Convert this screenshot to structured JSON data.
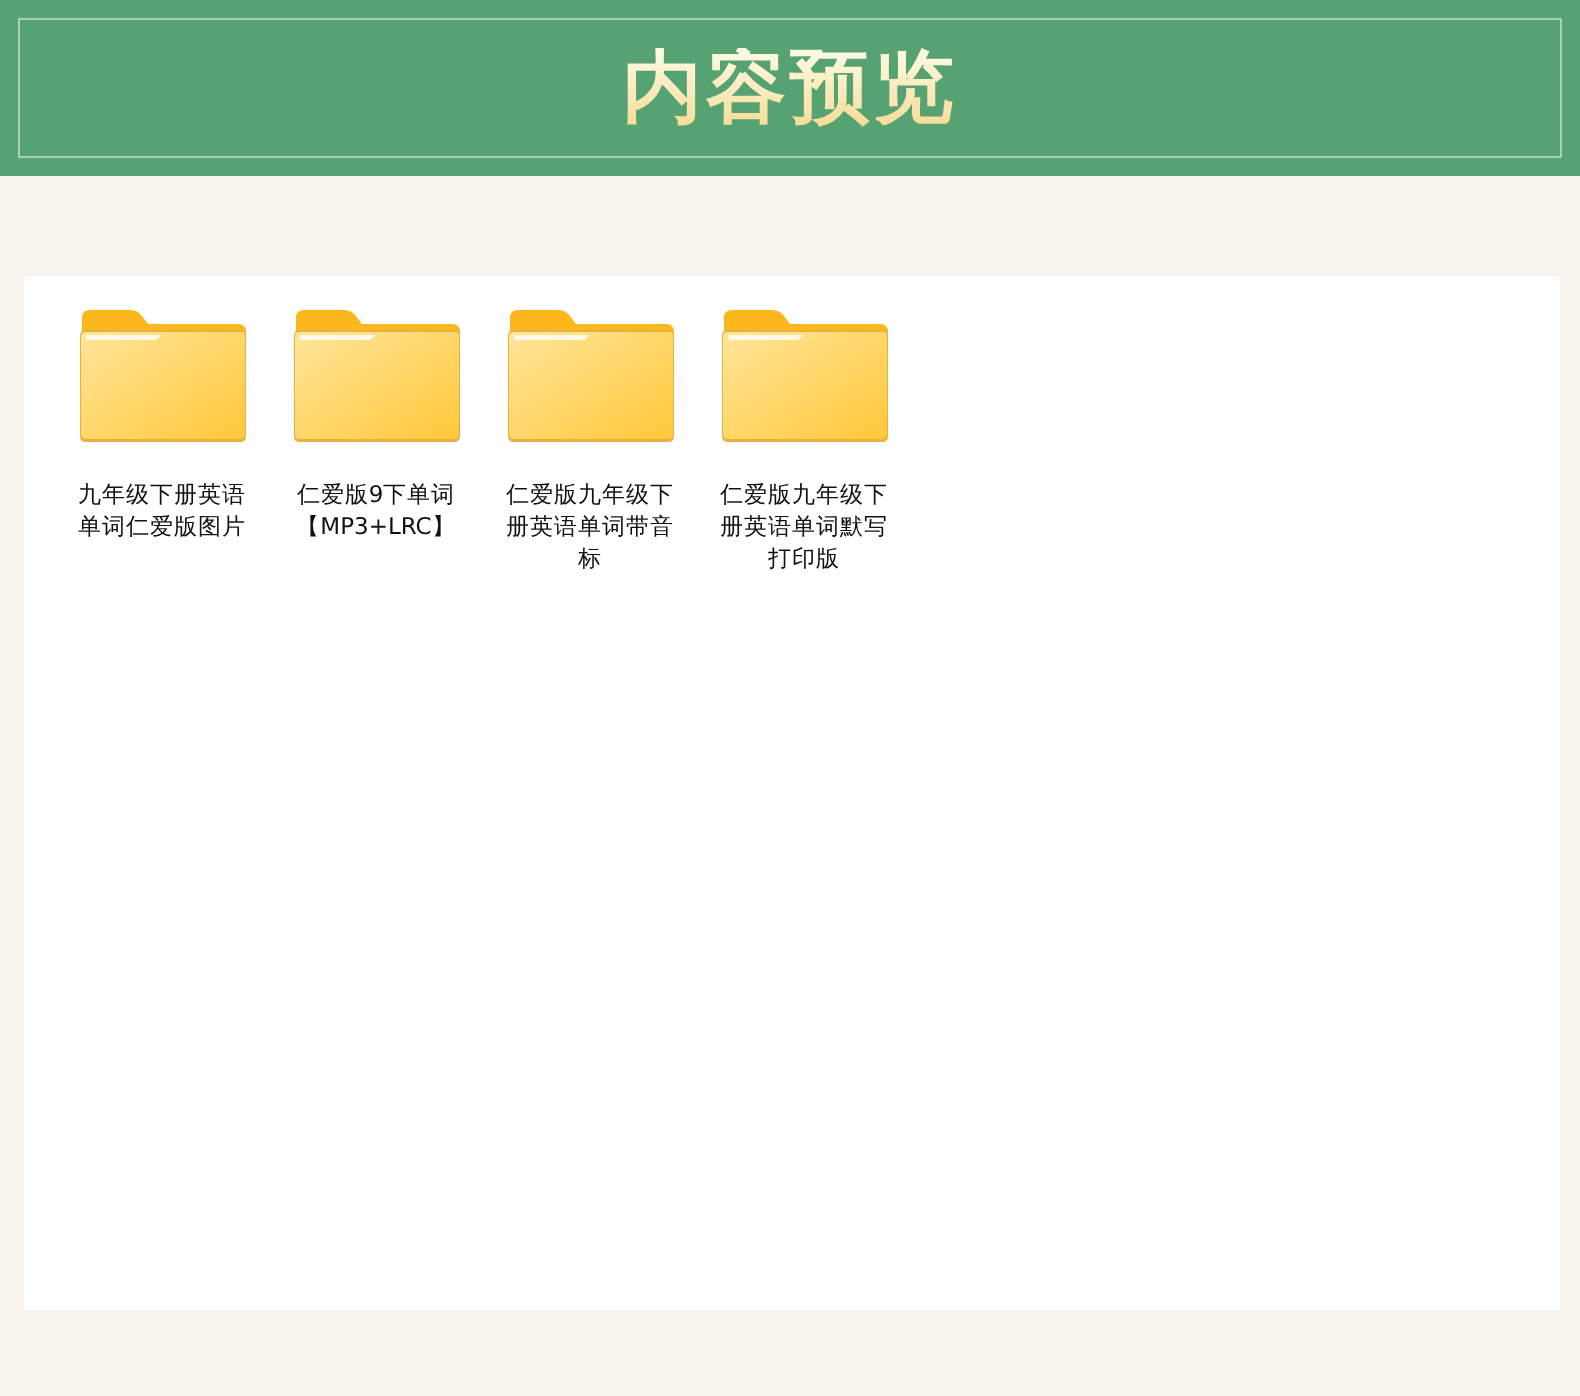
{
  "header": {
    "title": "内容预览"
  },
  "folders": [
    {
      "name": "九年级下册英语单词仁爱版图片"
    },
    {
      "name": "仁爱版9下单词【MP3+LRC】"
    },
    {
      "name": "仁爱版九年级下册英语单词带音标"
    },
    {
      "name": "仁爱版九年级下册英语单词默写打印版"
    }
  ]
}
